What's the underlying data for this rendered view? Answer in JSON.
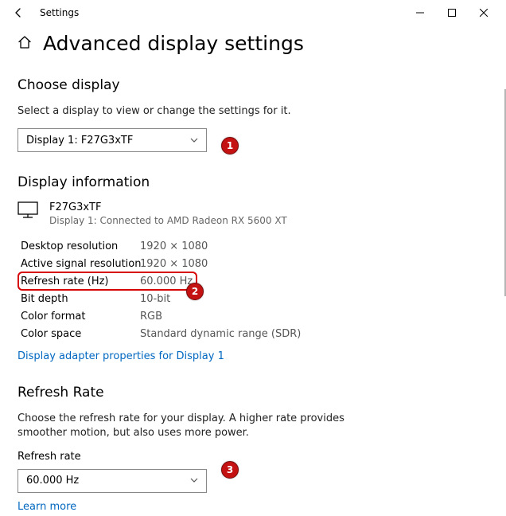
{
  "window": {
    "title": "Settings"
  },
  "header": {
    "title": "Advanced display settings"
  },
  "choose": {
    "heading": "Choose display",
    "help": "Select a display to view or change the settings for it.",
    "selected": "Display 1: F27G3xTF"
  },
  "info": {
    "heading": "Display information",
    "monitor_name": "F27G3xTF",
    "monitor_sub": "Display 1: Connected to AMD Radeon RX 5600 XT",
    "rows": [
      {
        "label": "Desktop resolution",
        "value": "1920 × 1080"
      },
      {
        "label": "Active signal resolution",
        "value": "1920 × 1080"
      },
      {
        "label": "Refresh rate (Hz)",
        "value": "60.000 Hz"
      },
      {
        "label": "Bit depth",
        "value": "10-bit"
      },
      {
        "label": "Color format",
        "value": "RGB"
      },
      {
        "label": "Color space",
        "value": "Standard dynamic range (SDR)"
      }
    ],
    "adapter_link": "Display adapter properties for Display 1"
  },
  "refresh": {
    "heading": "Refresh Rate",
    "help": "Choose the refresh rate for your display. A higher rate provides smoother motion, but also uses more power.",
    "label": "Refresh rate",
    "selected": "60.000 Hz",
    "learn_more": "Learn more"
  },
  "annotations": {
    "a1": "1",
    "a2": "2",
    "a3": "3"
  }
}
